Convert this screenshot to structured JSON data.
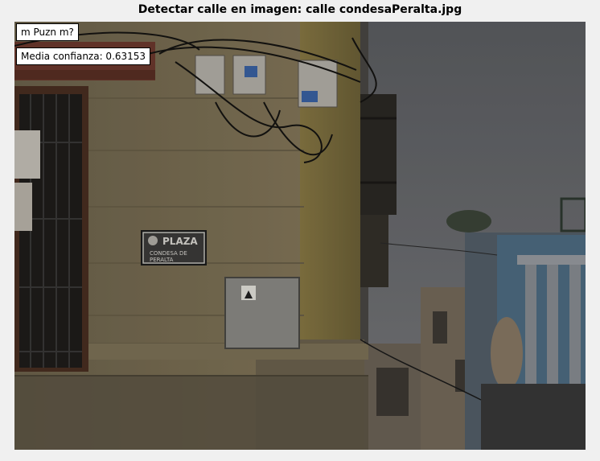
{
  "figure": {
    "title": "Detectar calle en imagen: calle condesaPeralta.jpg"
  },
  "annotations": {
    "label": "m Puzn m?",
    "confidence_text": "Media confianza: 0.63153"
  },
  "street_sign": {
    "line1": "PLAZA",
    "line2": "CONDESA DE",
    "line3": "PERALTA"
  },
  "colors": {
    "figure_background": "#f0f0f0",
    "building_wall": "#7d7055",
    "sky": "#6d6e72",
    "awning": "#7a3a2c"
  }
}
